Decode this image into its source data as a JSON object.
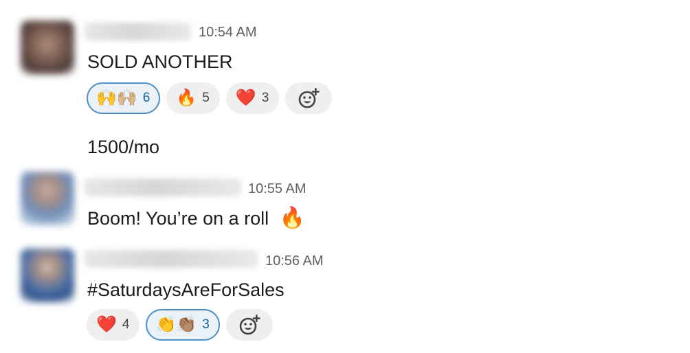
{
  "messages": [
    {
      "time": "10:54 AM",
      "text": "SOLD ANOTHER",
      "followup": "1500/mo",
      "reactions": [
        {
          "emoji": "🙌🙌🏼",
          "count": "6",
          "active": true
        },
        {
          "emoji": "🔥",
          "count": "5",
          "active": false
        },
        {
          "emoji": "❤️",
          "count": "3",
          "active": false
        }
      ]
    },
    {
      "time": "10:55 AM",
      "text": "Boom! You’re on a roll",
      "inline_emoji": "🔥"
    },
    {
      "time": "10:56 AM",
      "text": "#SaturdaysAreForSales",
      "reactions": [
        {
          "emoji": "❤️",
          "count": "4",
          "active": false
        },
        {
          "emoji": "👏👏🏽",
          "count": "3",
          "active": true
        }
      ]
    }
  ],
  "icons": {
    "add_reaction": "add-reaction-icon"
  },
  "colors": {
    "active_border": "#4f90c6",
    "active_bg": "#eaf2f8",
    "active_count": "#1264a3",
    "pill_bg": "#efefef",
    "timestamp": "#616061"
  }
}
